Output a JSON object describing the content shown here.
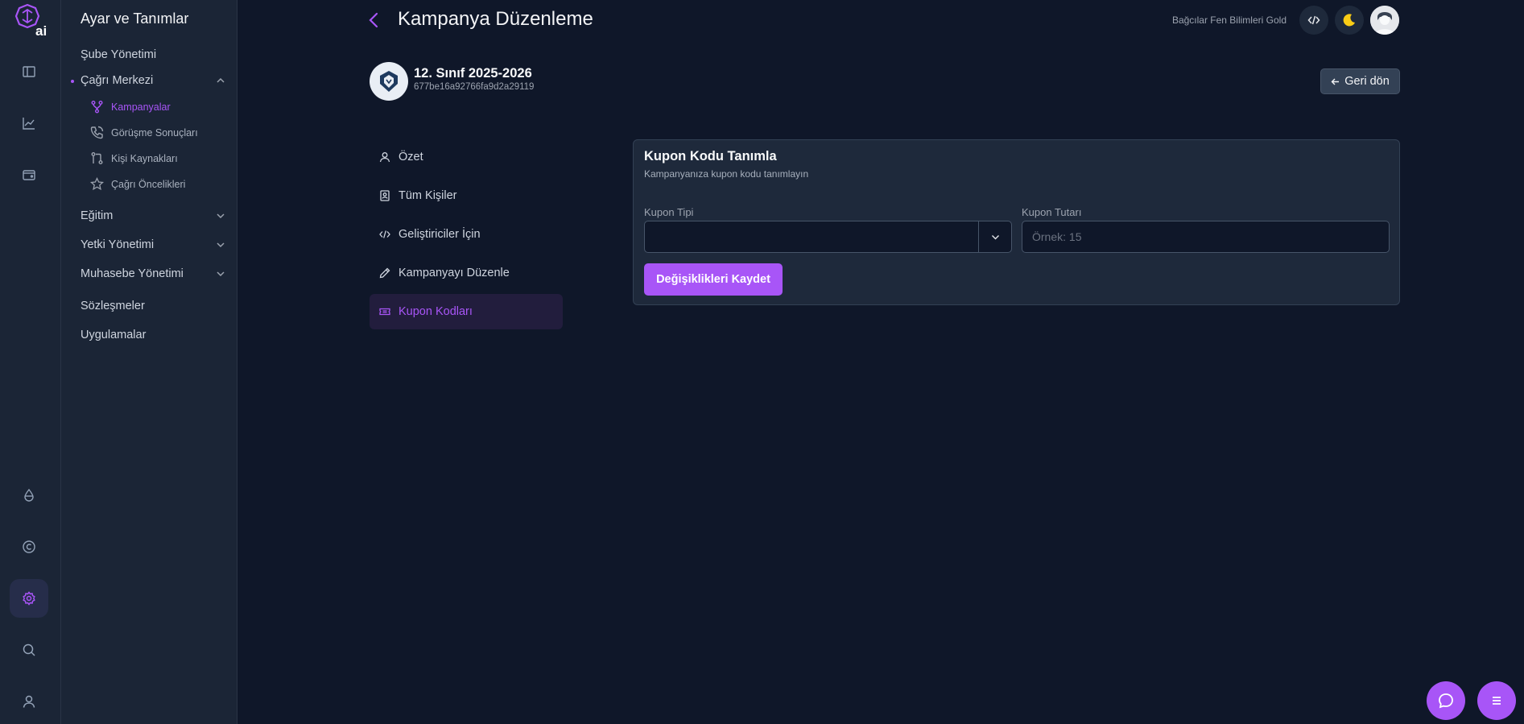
{
  "sidebar": {
    "title": "Ayar ve Tanımlar",
    "sube": "Şube Yönetimi",
    "cagri_merkezi": "Çağrı Merkezi",
    "sub_items": [
      "Kampanyalar",
      "Görüşme Sonuçları",
      "Kişi Kaynakları",
      "Çağrı Öncelikleri"
    ],
    "egitim": "Eğitim",
    "yetki": "Yetki Yönetimi",
    "muhasebe": "Muhasebe Yönetimi",
    "sozlesmeler": "Sözleşmeler",
    "uygulamalar": "Uygulamalar"
  },
  "header": {
    "title": "Kampanya Düzenleme",
    "org_name": "Bağcılar Fen Bilimleri Gold"
  },
  "campaign": {
    "name": "12. Sınıf 2025-2026",
    "id": "677be16a92766fa9d2a29119",
    "back_label": "Geri dön"
  },
  "nav": {
    "items": [
      "Özet",
      "Tüm Kişiler",
      "Geliştiriciler İçin",
      "Kampanyayı Düzenle",
      "Kupon Kodları"
    ],
    "active": "Kupon Kodları"
  },
  "card": {
    "title": "Kupon Kodu Tanımla",
    "subtitle": "Kampanyanıza kupon kodu tanımlayın",
    "kupon_tipi_label": "Kupon Tipi",
    "kupon_tipi_value": "",
    "kupon_tutari_label": "Kupon Tutarı",
    "kupon_tutari_placeholder": "Örnek: 15",
    "save_label": "Değişiklikleri Kaydet"
  },
  "colors": {
    "accent": "#a855f7",
    "background": "#0f1729",
    "panel": "#1b2536",
    "card": "#1e293b",
    "moon": "#facc15"
  },
  "icons": {
    "rail": [
      "brand-logo",
      "layout-icon",
      "chart-icon",
      "wallet-icon",
      "drop-icon",
      "copyright-icon",
      "settings-icon",
      "search-icon",
      "user-icon"
    ],
    "header": [
      "code-icon",
      "moon-icon"
    ],
    "fabs": [
      "chat-icon",
      "menu-icon"
    ]
  }
}
